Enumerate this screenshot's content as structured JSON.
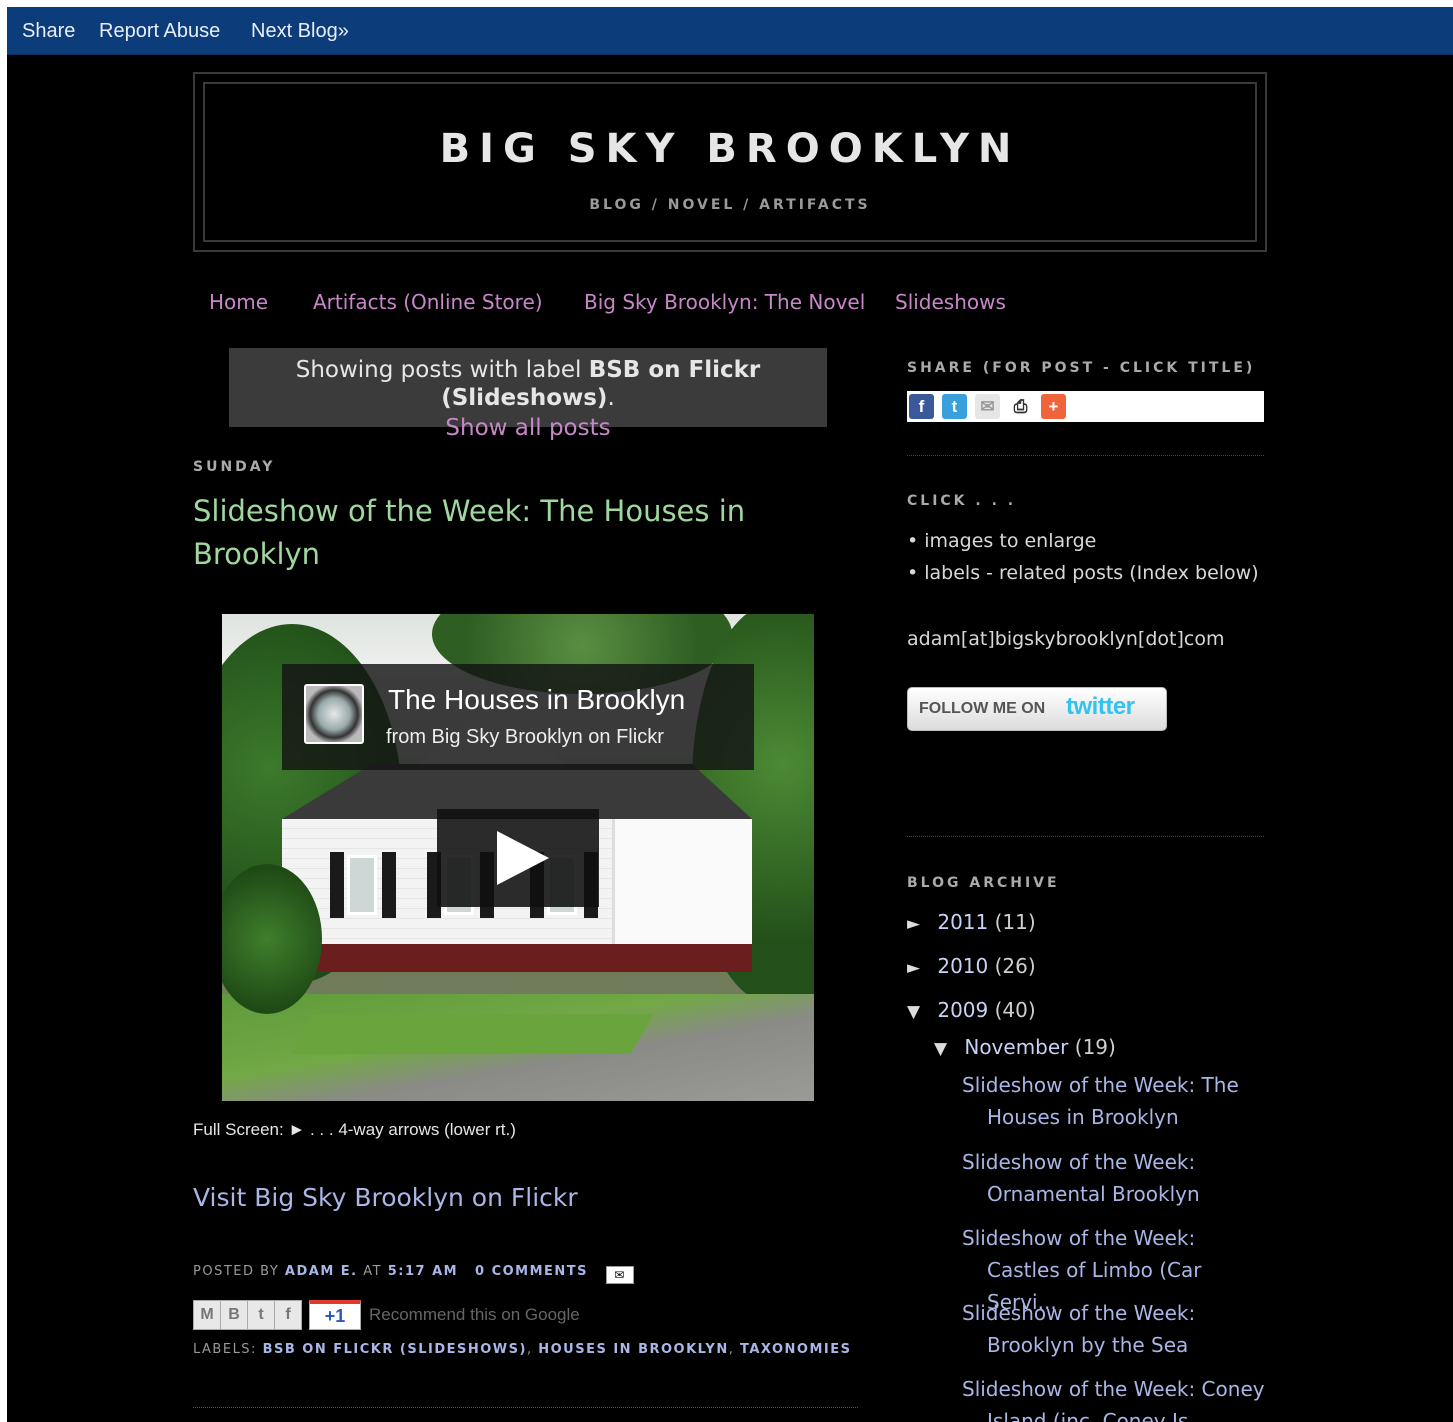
{
  "navbar": {
    "links": [
      "Share",
      "Report Abuse",
      "Next Blog»"
    ]
  },
  "header": {
    "title": "BIG SKY BROOKLYN",
    "description": "BLOG / NOVEL / ARTIFACTS"
  },
  "tabs": [
    "Home",
    "Artifacts (Online Store)",
    "Big Sky Brooklyn: The Novel",
    "Slideshows"
  ],
  "status": {
    "prefix": "Showing posts with label",
    "label": "BSB on Flickr (Slideshows)",
    "suffix": ".",
    "show_all": "Show all posts"
  },
  "post": {
    "date_header": "SUNDAY",
    "title": "Slideshow of the Week: The Houses in Brooklyn",
    "video": {
      "title": "The Houses in Brooklyn",
      "subtitle": "from Big Sky Brooklyn on Flickr"
    },
    "fullscreen_note": "Full Screen: ► . . . 4-way arrows (lower rt.)",
    "flickr_link": "Visit Big Sky Brooklyn on Flickr",
    "footer": {
      "posted_by": "POSTED BY",
      "author": "ADAM E.",
      "at": "AT",
      "time": "5:17 AM",
      "comments": "0 COMMENTS"
    },
    "share_buttons": [
      "M",
      "B",
      "t",
      "f"
    ],
    "plusone": "+1",
    "recommend": "Recommend this on Google",
    "labels_prefix": "LABELS:",
    "labels": [
      "BSB ON FLICKR (SLIDESHOWS)",
      "HOUSES IN BROOKLYN",
      "TAXONOMIES"
    ]
  },
  "sidebar": {
    "share_heading": "SHARE (FOR POST - CLICK TITLE)",
    "click_heading": "CLICK . . .",
    "click_items": [
      "• images to enlarge",
      "• labels - related posts (Index below)"
    ],
    "email": "adam[at]bigskybrooklyn[dot]com",
    "twitter": {
      "prefix": "FOLLOW ME ON",
      "brand": "twitter"
    },
    "archive_heading": "BLOG ARCHIVE",
    "archive": [
      {
        "marker": "►",
        "year": "2011",
        "count": "(11)"
      },
      {
        "marker": "►",
        "year": "2010",
        "count": "(26)"
      },
      {
        "marker": "▼",
        "year": "2009",
        "count": "(40)"
      }
    ],
    "month": {
      "marker": "▼",
      "name": "November",
      "count": "(19)"
    },
    "month_posts": [
      "Slideshow of the Week: The Houses in Brooklyn",
      "Slideshow of the Week: Ornamental Brooklyn",
      "Slideshow of the Week: Castles of Limbo (Car Servi...",
      "Slideshow of the Week: Brooklyn by the Sea",
      "Slideshow of the Week: Coney Island (inc. Coney Is..."
    ]
  },
  "colors": {
    "navbar": "#0c3c7a",
    "background": "#000000",
    "tab_link": "#c986c9",
    "post_title": "#9fd79f",
    "link": "#a9b6e6"
  }
}
